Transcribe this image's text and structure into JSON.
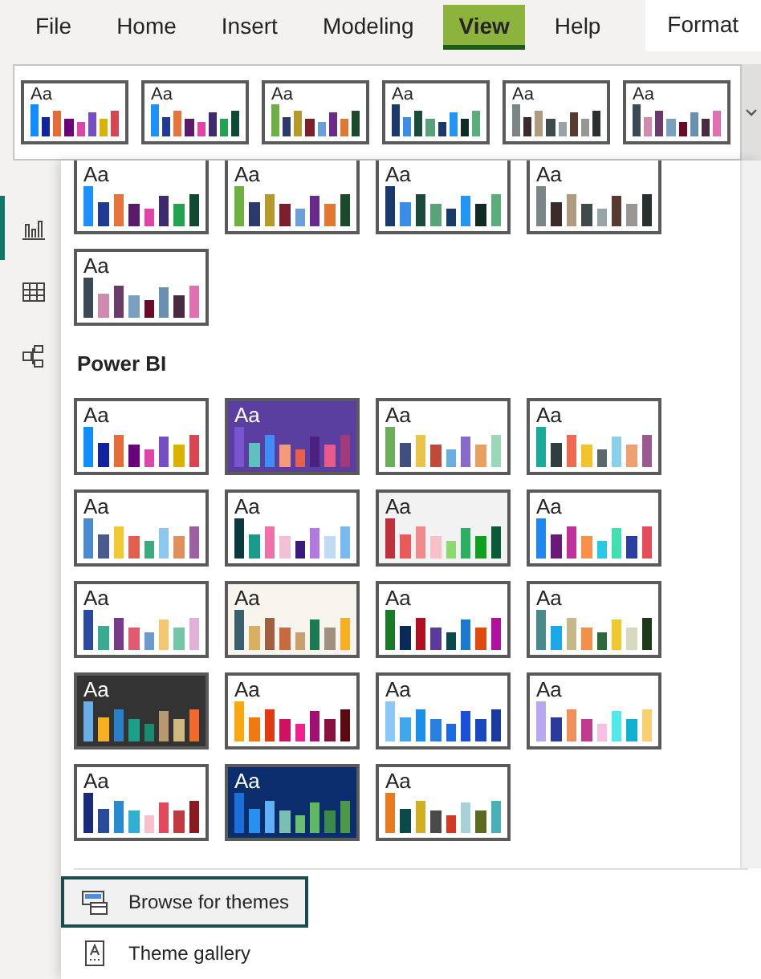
{
  "tabs": [
    {
      "label": "File",
      "selected": false,
      "kind": "standard"
    },
    {
      "label": "Home",
      "selected": false,
      "kind": "standard"
    },
    {
      "label": "Insert",
      "selected": false,
      "kind": "standard"
    },
    {
      "label": "Modeling",
      "selected": false,
      "kind": "standard"
    },
    {
      "label": "View",
      "selected": true,
      "kind": "standard"
    },
    {
      "label": "Help",
      "selected": false,
      "kind": "standard"
    },
    {
      "label": "Format",
      "selected": false,
      "kind": "contextual"
    }
  ],
  "ribbon_themes": [
    {
      "label": "Aa",
      "color": "#ffffff",
      "swatches": [
        {
          "color": "#118dff"
        },
        {
          "color": "#12239e"
        },
        {
          "color": "#e66c37"
        },
        {
          "color": "#6b007b"
        },
        {
          "color": "#e044a7"
        },
        {
          "color": "#744ec2"
        },
        {
          "color": "#d9b300"
        },
        {
          "color": "#d64550"
        }
      ]
    },
    {
      "label": "Aa",
      "color": "#ffffff",
      "swatches": [
        {
          "color": "#1e90ff"
        },
        {
          "color": "#1f3a93"
        },
        {
          "color": "#e8743b"
        },
        {
          "color": "#5b1b6b"
        },
        {
          "color": "#e044a7"
        },
        {
          "color": "#3f2a70"
        },
        {
          "color": "#23a34f"
        },
        {
          "color": "#0f4a32"
        }
      ]
    },
    {
      "label": "Aa",
      "color": "#ffffff",
      "swatches": [
        {
          "color": "#6fb043"
        },
        {
          "color": "#2b3a6b"
        },
        {
          "color": "#b59a2a"
        },
        {
          "color": "#7a1f2b"
        },
        {
          "color": "#6aa0d8"
        },
        {
          "color": "#6a2a8a"
        },
        {
          "color": "#e0782f"
        },
        {
          "color": "#1a4a2a"
        }
      ]
    },
    {
      "label": "Aa",
      "color": "#ffffff",
      "swatches": [
        {
          "color": "#1a3a6b"
        },
        {
          "color": "#3a8ee6"
        },
        {
          "color": "#1a4a3a"
        },
        {
          "color": "#5aa37a"
        },
        {
          "color": "#1a3a6c"
        },
        {
          "color": "#2196f3"
        },
        {
          "color": "#0f2a22"
        },
        {
          "color": "#5aae7a"
        }
      ]
    },
    {
      "label": "Aa",
      "color": "#ffffff",
      "swatches": [
        {
          "color": "#7a8587"
        },
        {
          "color": "#3a2a2a"
        },
        {
          "color": "#b09a80"
        },
        {
          "color": "#3f4a4a"
        },
        {
          "color": "#98a5a8"
        },
        {
          "color": "#5a3a30"
        },
        {
          "color": "#9a9590"
        },
        {
          "color": "#2a2f2f"
        }
      ]
    },
    {
      "label": "Aa",
      "color": "#ffffff",
      "swatches": [
        {
          "color": "#3a4a55"
        },
        {
          "color": "#d08ab0"
        },
        {
          "color": "#6a3a6a"
        },
        {
          "color": "#7aa0c0"
        },
        {
          "color": "#6a0a2a"
        },
        {
          "color": "#6a90b0"
        },
        {
          "color": "#4a2a40"
        },
        {
          "color": "#e070b0"
        }
      ]
    }
  ],
  "sidebar": {
    "items": [
      {
        "kind": "report",
        "selected": true
      },
      {
        "kind": "table",
        "selected": false
      },
      {
        "kind": "model",
        "selected": false
      }
    ]
  },
  "theme_menu": {
    "sections": [
      {
        "themes": [
          {
            "label": "Aa",
            "color": "#ffffff",
            "swatches": [
              {
                "color": "#1e90ff"
              },
              {
                "color": "#1f3a93"
              },
              {
                "color": "#e8743b"
              },
              {
                "color": "#5b1b6b"
              },
              {
                "color": "#e044a7"
              },
              {
                "color": "#3f2a70"
              },
              {
                "color": "#23a34f"
              },
              {
                "color": "#0f4a32"
              }
            ]
          },
          {
            "label": "Aa",
            "color": "#ffffff",
            "swatches": [
              {
                "color": "#6fb043"
              },
              {
                "color": "#2b3a6b"
              },
              {
                "color": "#b59a2a"
              },
              {
                "color": "#7a1f2b"
              },
              {
                "color": "#6aa0d8"
              },
              {
                "color": "#6a2a8a"
              },
              {
                "color": "#e0782f"
              },
              {
                "color": "#1a4a2a"
              }
            ]
          },
          {
            "label": "Aa",
            "color": "#ffffff",
            "swatches": [
              {
                "color": "#1a3a6b"
              },
              {
                "color": "#3a8ee6"
              },
              {
                "color": "#1a4a3a"
              },
              {
                "color": "#5aa37a"
              },
              {
                "color": "#1a3a6c"
              },
              {
                "color": "#2196f3"
              },
              {
                "color": "#0f2a22"
              },
              {
                "color": "#5aae7a"
              }
            ]
          },
          {
            "label": "Aa",
            "color": "#ffffff",
            "swatches": [
              {
                "color": "#7a8587"
              },
              {
                "color": "#3a2a2a"
              },
              {
                "color": "#b09a80"
              },
              {
                "color": "#3f4a4a"
              },
              {
                "color": "#98a5a8"
              },
              {
                "color": "#5a3a30"
              },
              {
                "color": "#9a9590"
              },
              {
                "color": "#2a2f2f"
              }
            ]
          },
          {
            "label": "Aa",
            "color": "#ffffff",
            "swatches": [
              {
                "color": "#3a4a55"
              },
              {
                "color": "#d08ab0"
              },
              {
                "color": "#6a3a6a"
              },
              {
                "color": "#7aa0c0"
              },
              {
                "color": "#6a0a2a"
              },
              {
                "color": "#6a90b0"
              },
              {
                "color": "#4a2a40"
              },
              {
                "color": "#e070b0"
              }
            ]
          }
        ]
      },
      {
        "heading": "Power BI",
        "themes": [
          {
            "label": "Aa",
            "color": "#ffffff",
            "swatches": [
              {
                "color": "#118dff"
              },
              {
                "color": "#12239e"
              },
              {
                "color": "#e66c37"
              },
              {
                "color": "#6b007b"
              },
              {
                "color": "#e044a7"
              },
              {
                "color": "#744ec2"
              },
              {
                "color": "#d9b300"
              },
              {
                "color": "#d64550"
              }
            ]
          },
          {
            "label": "Aa",
            "color": "#5b3fa0",
            "swatches": [
              {
                "color": "#7a55d0"
              },
              {
                "color": "#5fc0c0"
              },
              {
                "color": "#3d8df5"
              },
              {
                "color": "#f59a7a"
              },
              {
                "color": "#e8604c"
              },
              {
                "color": "#4a2080"
              },
              {
                "color": "#e85a8a"
              },
              {
                "color": "#a03a7a"
              }
            ]
          },
          {
            "label": "Aa",
            "color": "#ffffff",
            "swatches": [
              {
                "color": "#6aaf5a"
              },
              {
                "color": "#3f4f80"
              },
              {
                "color": "#e8c44a"
              },
              {
                "color": "#c04a3a"
              },
              {
                "color": "#6aaede"
              },
              {
                "color": "#8a6ac8"
              },
              {
                "color": "#e8a060"
              },
              {
                "color": "#9ad8b8"
              }
            ]
          },
          {
            "label": "Aa",
            "color": "#ffffff",
            "swatches": [
              {
                "color": "#1aaa9a"
              },
              {
                "color": "#2f3f40"
              },
              {
                "color": "#f06a50"
              },
              {
                "color": "#f2c32a"
              },
              {
                "color": "#5a6a6a"
              },
              {
                "color": "#8ccfe8"
              },
              {
                "color": "#f0a070"
              },
              {
                "color": "#9a5a90"
              }
            ]
          },
          {
            "label": "Aa",
            "color": "#ffffff",
            "swatches": [
              {
                "color": "#4a8ad0"
              },
              {
                "color": "#4a5a8a"
              },
              {
                "color": "#f2c830"
              },
              {
                "color": "#e06050"
              },
              {
                "color": "#3aaa80"
              },
              {
                "color": "#8cc8ee"
              },
              {
                "color": "#e0905a"
              },
              {
                "color": "#9a60a0"
              }
            ]
          },
          {
            "label": "Aa",
            "color": "#ffffff",
            "swatches": [
              {
                "color": "#0a3a40"
              },
              {
                "color": "#1a9a8a"
              },
              {
                "color": "#f070a8"
              },
              {
                "color": "#f4c0d8"
              },
              {
                "color": "#3a1a7a"
              },
              {
                "color": "#b07ae0"
              },
              {
                "color": "#c0dcf4"
              },
              {
                "color": "#7ab8f0"
              }
            ]
          },
          {
            "label": "Aa",
            "color": "#f2f2f2",
            "swatches": [
              {
                "color": "#c0303a"
              },
              {
                "color": "#e85a5a"
              },
              {
                "color": "#f08a8a"
              },
              {
                "color": "#f8c0c8"
              },
              {
                "color": "#8ada70"
              },
              {
                "color": "#2ab060"
              },
              {
                "color": "#10a020"
              },
              {
                "color": "#0a5a3a"
              }
            ]
          },
          {
            "label": "Aa",
            "color": "#ffffff",
            "swatches": [
              {
                "color": "#1e88f0"
              },
              {
                "color": "#6a1a7a"
              },
              {
                "color": "#c0309a"
              },
              {
                "color": "#f8904a"
              },
              {
                "color": "#2ac8e8"
              },
              {
                "color": "#40e0b0"
              },
              {
                "color": "#2a40a0"
              },
              {
                "color": "#e84a5a"
              }
            ]
          },
          {
            "label": "Aa",
            "color": "#ffffff",
            "swatches": [
              {
                "color": "#2a4aa0"
              },
              {
                "color": "#3aaa90"
              },
              {
                "color": "#7a3a8a"
              },
              {
                "color": "#e05a70"
              },
              {
                "color": "#6a9ad0"
              },
              {
                "color": "#f2c870"
              },
              {
                "color": "#70c8a8"
              },
              {
                "color": "#e0b0d8"
              }
            ]
          },
          {
            "label": "Aa",
            "color": "#f8f5ee",
            "swatches": [
              {
                "color": "#3a6070"
              },
              {
                "color": "#d8b060"
              },
              {
                "color": "#a06040"
              },
              {
                "color": "#c86a40"
              },
              {
                "color": "#c8a070"
              },
              {
                "color": "#1a7a50"
              },
              {
                "color": "#a09080"
              },
              {
                "color": "#f8b020"
              }
            ]
          },
          {
            "label": "Aa",
            "color": "#ffffff",
            "swatches": [
              {
                "color": "#1a7a2a"
              },
              {
                "color": "#0a2a5a"
              },
              {
                "color": "#b01020"
              },
              {
                "color": "#5a3a9a"
              },
              {
                "color": "#0a4a4a"
              },
              {
                "color": "#1a7ad0"
              },
              {
                "color": "#e04a10"
              },
              {
                "color": "#b010a0"
              }
            ]
          },
          {
            "label": "Aa",
            "color": "#ffffff",
            "swatches": [
              {
                "color": "#4a8a8a"
              },
              {
                "color": "#1aa8e8"
              },
              {
                "color": "#c8b888"
              },
              {
                "color": "#f0904a"
              },
              {
                "color": "#2a6a3a"
              },
              {
                "color": "#f0c830"
              },
              {
                "color": "#d8d8c0"
              },
              {
                "color": "#1a3a1a"
              }
            ]
          },
          {
            "label": "Aa",
            "color": "#333333",
            "swatches": [
              {
                "color": "#6aaee8"
              },
              {
                "color": "#f8b020"
              },
              {
                "color": "#2a80c8"
              },
              {
                "color": "#1aa088"
              },
              {
                "color": "#1a8a70"
              },
              {
                "color": "#b89870"
              },
              {
                "color": "#d0b880"
              },
              {
                "color": "#f06a30"
              }
            ]
          },
          {
            "label": "Aa",
            "color": "#ffffff",
            "swatches": [
              {
                "color": "#f8a810"
              },
              {
                "color": "#f07a10"
              },
              {
                "color": "#e03a10"
              },
              {
                "color": "#d01060"
              },
              {
                "color": "#f02090"
              },
              {
                "color": "#a01070"
              },
              {
                "color": "#8a1040"
              },
              {
                "color": "#5a0a10"
              }
            ]
          },
          {
            "label": "Aa",
            "color": "#ffffff",
            "swatches": [
              {
                "color": "#8ac8f8"
              },
              {
                "color": "#40a8e8"
              },
              {
                "color": "#1a90e8"
              },
              {
                "color": "#2880e0"
              },
              {
                "color": "#1a6ae0"
              },
              {
                "color": "#1a50d8"
              },
              {
                "color": "#1a48c0"
              },
              {
                "color": "#1a3aa0"
              }
            ]
          },
          {
            "label": "Aa",
            "color": "#ffffff",
            "swatches": [
              {
                "color": "#b8a8f0"
              },
              {
                "color": "#2a3a9a"
              },
              {
                "color": "#f0905a"
              },
              {
                "color": "#c03a90"
              },
              {
                "color": "#f8c0e0"
              },
              {
                "color": "#50e8e8"
              },
              {
                "color": "#10b0d0"
              },
              {
                "color": "#f8d070"
              }
            ]
          },
          {
            "label": "Aa",
            "color": "#ffffff",
            "swatches": [
              {
                "color": "#1a2a7a"
              },
              {
                "color": "#2a4a9a"
              },
              {
                "color": "#2a8ad0"
              },
              {
                "color": "#30b0d0"
              },
              {
                "color": "#f8c0c8"
              },
              {
                "color": "#e04a5a"
              },
              {
                "color": "#c03a40"
              },
              {
                "color": "#8a1a20"
              }
            ]
          },
          {
            "label": "Aa",
            "color": "#0b2d6b",
            "swatches": [
              {
                "color": "#1a70d8"
              },
              {
                "color": "#2a90f0"
              },
              {
                "color": "#60b0f8"
              },
              {
                "color": "#7ac0b0"
              },
              {
                "color": "#6ac070"
              },
              {
                "color": "#60b860"
              },
              {
                "color": "#3a8a4a"
              },
              {
                "color": "#4a9a4a"
              }
            ]
          },
          {
            "label": "Aa",
            "color": "#ffffff",
            "swatches": [
              {
                "color": "#e87a20"
              },
              {
                "color": "#0a4a4a"
              },
              {
                "color": "#d0b020"
              },
              {
                "color": "#4a4a4a"
              },
              {
                "color": "#d03a20"
              },
              {
                "color": "#a8d0d8"
              },
              {
                "color": "#5a6a20"
              },
              {
                "color": "#4ab0b8"
              }
            ]
          }
        ]
      }
    ],
    "actions": [
      {
        "kind": "browse",
        "label": "Browse for themes",
        "selected": true
      },
      {
        "kind": "gallery",
        "label": "Theme gallery",
        "selected": false
      }
    ]
  }
}
